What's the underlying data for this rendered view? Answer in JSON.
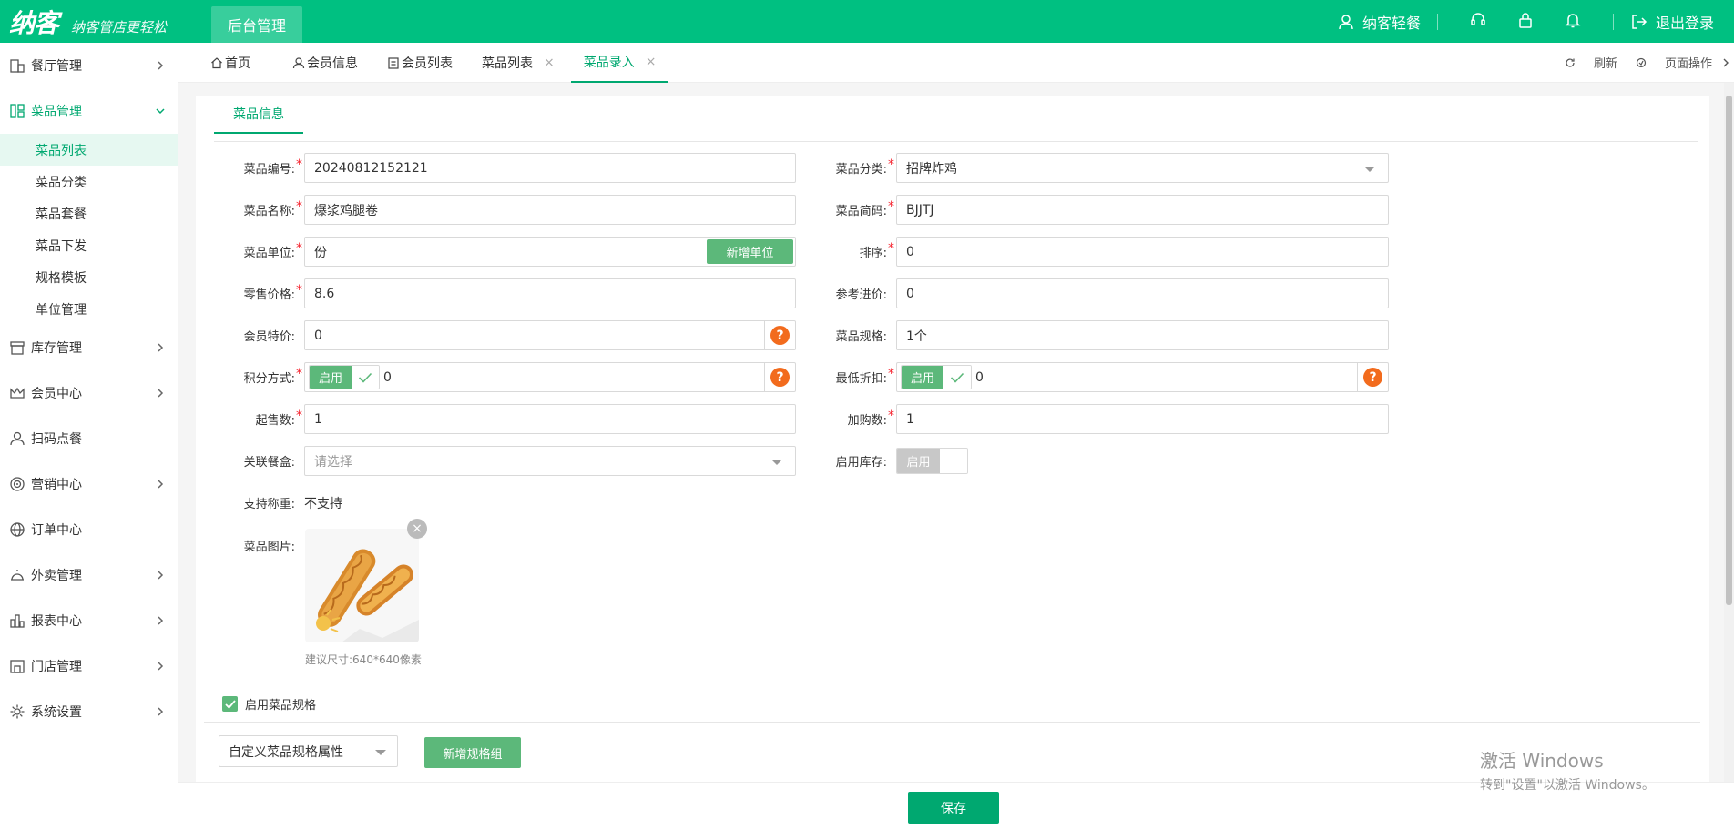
{
  "header": {
    "logo": "纳客",
    "slogan": "纳客管店更轻松",
    "active_module": "后台管理",
    "user_name": "纳客轻餐",
    "logout": "退出登录"
  },
  "sidebar": {
    "items": [
      {
        "label": "餐厅管理"
      },
      {
        "label": "菜品管理"
      },
      {
        "label": "库存管理"
      },
      {
        "label": "会员中心"
      },
      {
        "label": "扫码点餐"
      },
      {
        "label": "营销中心"
      },
      {
        "label": "订单中心"
      },
      {
        "label": "外卖管理"
      },
      {
        "label": "报表中心"
      },
      {
        "label": "门店管理"
      },
      {
        "label": "系统设置"
      }
    ],
    "sub_items": [
      {
        "label": "菜品列表"
      },
      {
        "label": "菜品分类"
      },
      {
        "label": "菜品套餐"
      },
      {
        "label": "菜品下发"
      },
      {
        "label": "规格模板"
      },
      {
        "label": "单位管理"
      }
    ]
  },
  "tabs": [
    {
      "label": "首页"
    },
    {
      "label": "会员信息"
    },
    {
      "label": "会员列表"
    },
    {
      "label": "菜品列表",
      "close": "×"
    },
    {
      "label": "菜品录入",
      "close": "×"
    }
  ],
  "tab_actions": {
    "refresh": "刷新",
    "page_ops": "页面操作"
  },
  "form": {
    "section_title": "菜品信息",
    "code": {
      "label": "菜品编号:",
      "value": "20240812152121"
    },
    "category": {
      "label": "菜品分类:",
      "value": "招牌炸鸡"
    },
    "name": {
      "label": "菜品名称:",
      "value": "爆浆鸡腿卷"
    },
    "short_code": {
      "label": "菜品简码:",
      "value": "BJJTJ"
    },
    "unit": {
      "label": "菜品单位:",
      "value": "份",
      "add_button": "新增单位"
    },
    "sort": {
      "label": "排序:",
      "value": "0"
    },
    "retail_price": {
      "label": "零售价格:",
      "value": "8.6"
    },
    "ref_price": {
      "label": "参考进价:",
      "value": "0"
    },
    "member_price": {
      "label": "会员特价:",
      "value": "0",
      "help": "?"
    },
    "spec": {
      "label": "菜品规格:",
      "value": "1个"
    },
    "points": {
      "label": "积分方式:",
      "toggle": "启用",
      "value": "0",
      "help": "?"
    },
    "min_discount": {
      "label": "最低折扣:",
      "toggle": "启用",
      "value": "0",
      "help": "?"
    },
    "min_qty": {
      "label": "起售数:",
      "value": "1"
    },
    "add_qty": {
      "label": "加购数:",
      "value": "1"
    },
    "box": {
      "label": "关联餐盒:",
      "placeholder": "请选择"
    },
    "stock": {
      "label": "启用库存:",
      "toggle": "启用"
    },
    "weigh": {
      "label": "支持称重:",
      "value": "不支持"
    },
    "image": {
      "label": "菜品图片:",
      "hint": "建议尺寸:640*640像素",
      "close": "×"
    },
    "enable_spec": "启用菜品规格",
    "spec_select": "自定义菜品规格属性",
    "add_spec_group": "新增规格组"
  },
  "footer": {
    "save": "保存"
  },
  "watermark": {
    "line1": "激活 Windows",
    "line2": "转到\"设置\"以激活 Windows。"
  }
}
